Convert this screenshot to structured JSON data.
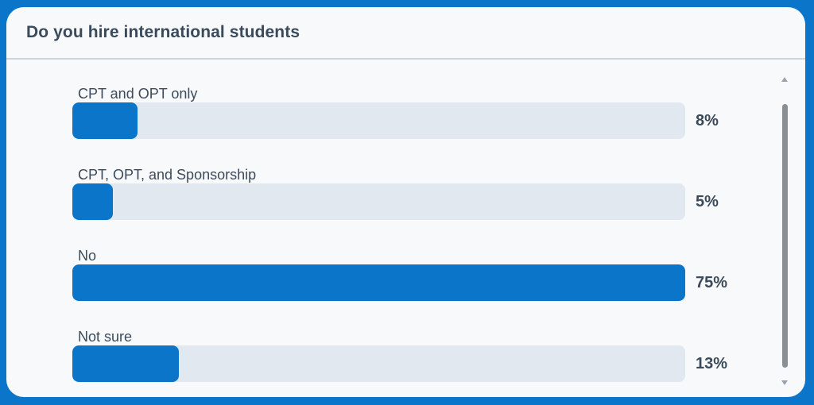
{
  "poll": {
    "title": "Do you hire international students"
  },
  "options": [
    {
      "label": "CPT and OPT only",
      "percent_text": "8%"
    },
    {
      "label": "CPT, OPT, and Sponsorship",
      "percent_text": "5%"
    },
    {
      "label": "No",
      "percent_text": "75%"
    },
    {
      "label": "Not sure",
      "percent_text": "13%"
    }
  ],
  "colors": {
    "frame": "#0a75c9",
    "bar_fill": "#0a75c9",
    "bar_track": "#e1e8f0",
    "card_bg": "#f7f9fb"
  },
  "chart_data": {
    "type": "bar",
    "orientation": "horizontal",
    "title": "Do you hire international students",
    "categories": [
      "CPT and OPT only",
      "CPT, OPT, and Sponsorship",
      "No",
      "Not sure"
    ],
    "values": [
      8,
      5,
      75,
      13
    ],
    "unit": "%",
    "bar_scale_max": 75,
    "grid": false,
    "legend": "none"
  },
  "scrollbar": {
    "up_icon": "scroll-up-arrow",
    "down_icon": "scroll-down-arrow"
  }
}
